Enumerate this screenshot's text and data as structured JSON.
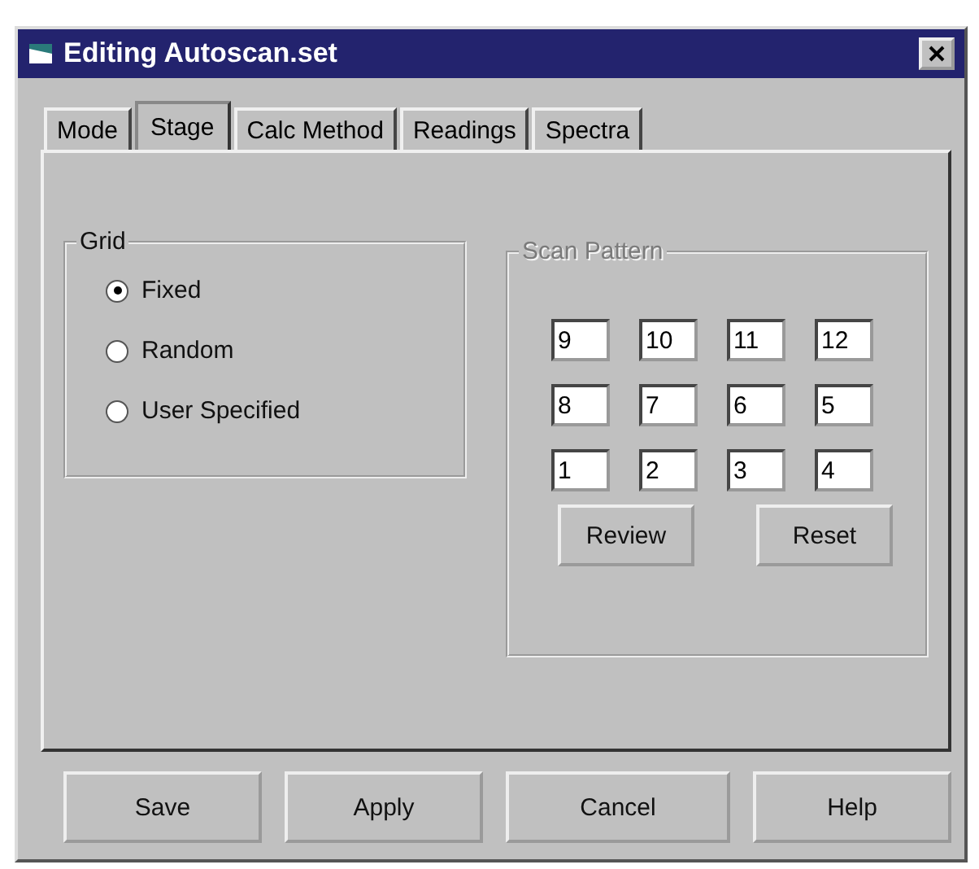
{
  "window": {
    "title": "Editing Autoscan.set"
  },
  "tabs": [
    {
      "label": "Mode",
      "selected": false
    },
    {
      "label": "Stage",
      "selected": true
    },
    {
      "label": "Calc Method",
      "selected": false
    },
    {
      "label": "Readings",
      "selected": false
    },
    {
      "label": "Spectra",
      "selected": false
    }
  ],
  "grid": {
    "label": "Grid",
    "options": [
      {
        "label": "Fixed",
        "selected": true
      },
      {
        "label": "Random",
        "selected": false
      },
      {
        "label": "User Specified",
        "selected": false
      }
    ]
  },
  "scan_pattern": {
    "label": "Scan Pattern",
    "disabled": true,
    "rows": [
      [
        "9",
        "10",
        "11",
        "12"
      ],
      [
        "8",
        "7",
        "6",
        "5"
      ],
      [
        "1",
        "2",
        "3",
        "4"
      ]
    ],
    "buttons": [
      "Review",
      "Reset"
    ]
  },
  "buttons": [
    "Save",
    "Apply",
    "Cancel",
    "Help"
  ]
}
